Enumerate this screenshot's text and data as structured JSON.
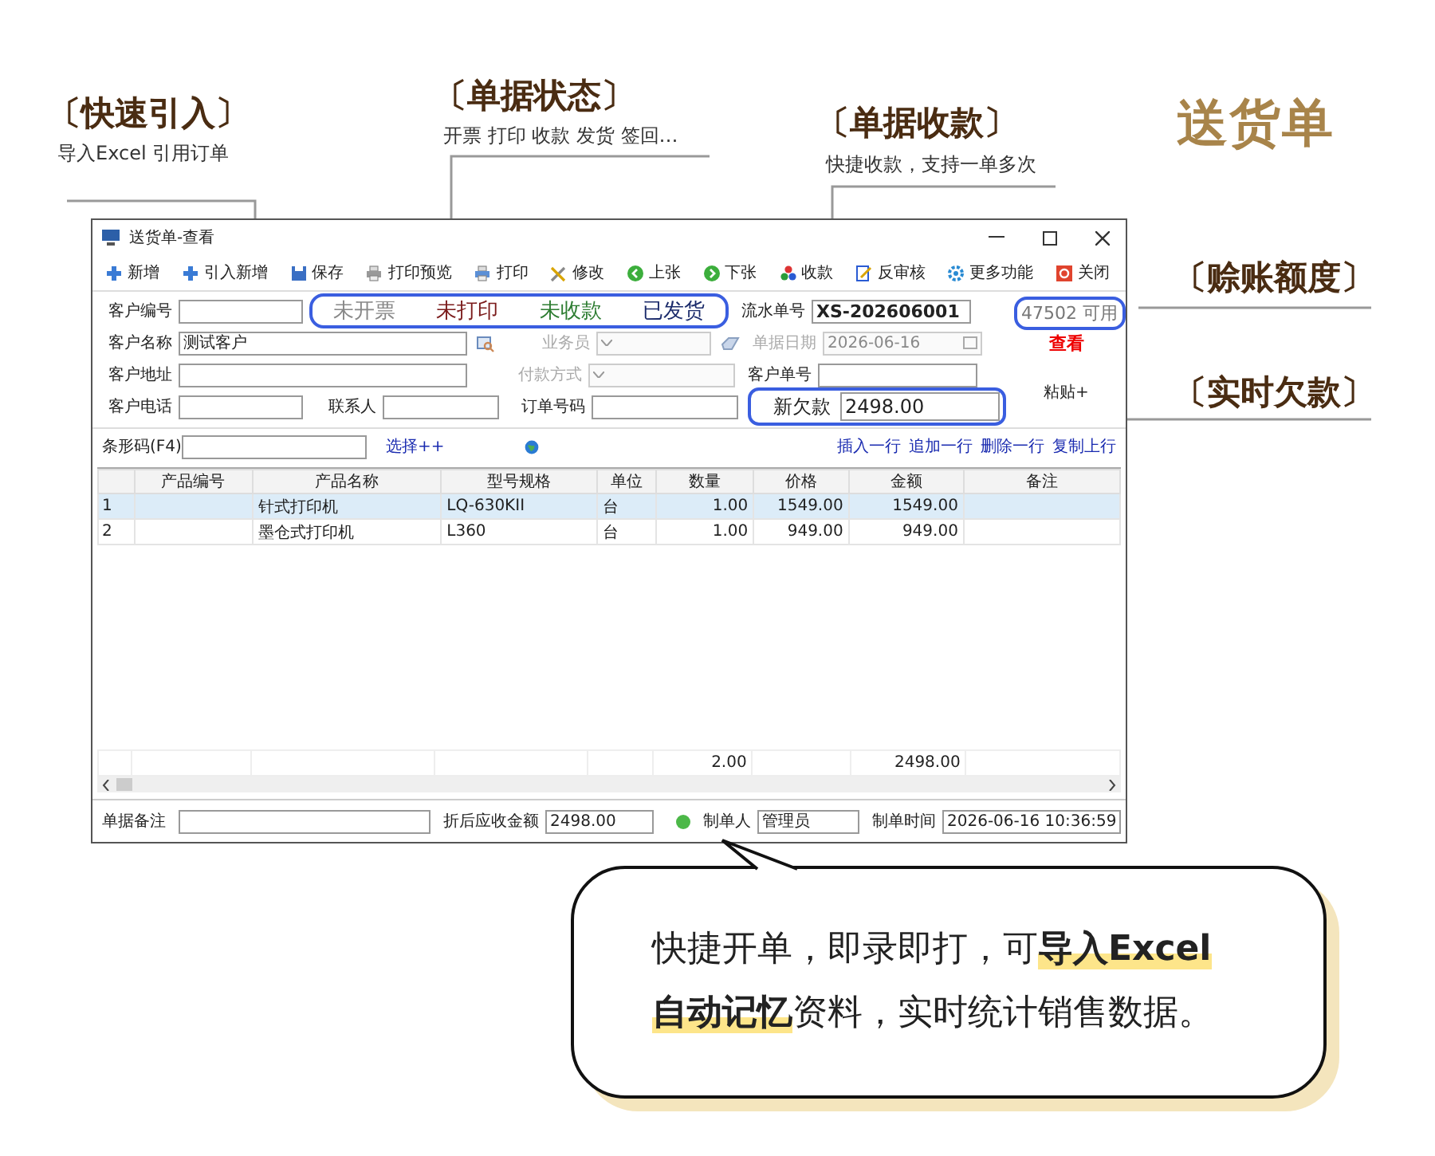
{
  "page_title": "送货单",
  "callouts": [
    {
      "title": "〔快速引入〕",
      "subtitle": "导入Excel 引用订单"
    },
    {
      "title": "〔单据状态〕",
      "subtitle": "开票 打印 收款 发货 签回…"
    },
    {
      "title": "〔单据收款〕",
      "subtitle": "快捷收款，支持一单多次"
    },
    {
      "title": "〔赊账额度〕"
    },
    {
      "title": "〔实时欠款〕"
    }
  ],
  "window": {
    "title": "送货单-查看",
    "toolbar": [
      "新增",
      "引入新增",
      "保存",
      "打印预览",
      "打印",
      "修改",
      "上张",
      "下张",
      "收款",
      "反审核",
      "更多功能",
      "关闭"
    ],
    "status_badges": [
      {
        "label": "未开票",
        "color": "#888888"
      },
      {
        "label": "未打印",
        "color": "#7a1a1a"
      },
      {
        "label": "未收款",
        "color": "#2e7d32"
      },
      {
        "label": "已发货",
        "color": "#1a2a6a"
      }
    ],
    "credit": "47502 可用",
    "view_link": "查看",
    "paste_link": "粘贴+",
    "form": {
      "customer_code": {
        "label": "客户编号"
      },
      "customer_name": {
        "label": "客户名称",
        "value": "测试客户"
      },
      "address": {
        "label": "客户地址"
      },
      "phone": {
        "label": "客户电话"
      },
      "contact": {
        "label": "联系人"
      },
      "salesperson": {
        "label": "业务员",
        "disabled": true
      },
      "payment_method": {
        "label": "付款方式",
        "disabled": true
      },
      "order_no": {
        "label": "订单号码"
      },
      "serial_no": {
        "label": "流水单号",
        "value": "XS-202606001"
      },
      "date": {
        "label": "单据日期",
        "value": "2026-06-16",
        "disabled": true
      },
      "customer_order_no": {
        "label": "客户单号"
      },
      "new_debt": {
        "label": "新欠款",
        "value": "2498.00"
      }
    },
    "barcode": {
      "label": "条形码(F4)",
      "select_link": "选择++"
    },
    "row_actions": [
      "插入一行",
      "追加一行",
      "删除一行",
      "复制上行"
    ],
    "table": {
      "columns": [
        "产品编号",
        "产品名称",
        "型号规格",
        "单位",
        "数量",
        "价格",
        "金额",
        "备注"
      ],
      "rows": [
        {
          "index": "1",
          "cells": [
            "",
            "针式打印机",
            "LQ-630KII",
            "台",
            "1.00",
            "1549.00",
            "1549.00",
            ""
          ],
          "selected": true
        },
        {
          "index": "2",
          "cells": [
            "",
            "墨仓式打印机",
            "L360",
            "台",
            "1.00",
            "949.00",
            "949.00",
            ""
          ],
          "selected": false
        }
      ],
      "totals": {
        "quantity": "2.00",
        "amount": "2498.00"
      }
    },
    "footer": {
      "remark": {
        "label": "单据备注"
      },
      "discounted": {
        "label": "折后应收金额",
        "value": "2498.00"
      },
      "creator": {
        "label": "制单人",
        "value": "管理员"
      },
      "time": {
        "label": "制单时间",
        "value": "2026-06-16 10:36:59"
      }
    }
  },
  "bubble": {
    "text": "快捷开单，即录即打，可**导入Excel自动记忆**资料，实时统计销售数据。"
  }
}
